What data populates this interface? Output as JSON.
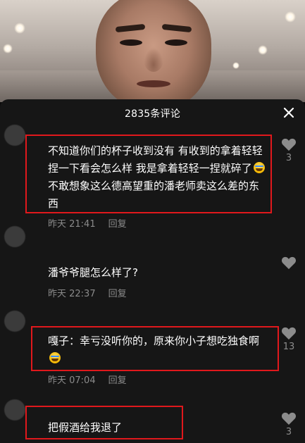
{
  "sheet": {
    "title": "2835条评论",
    "close_icon": "close-icon"
  },
  "comments": [
    {
      "text_part1": "不知道你们的杯子收到没有 有收到的拿着轻轻捏一下看会怎么样 我是拿着轻轻一捏就碎了",
      "emoji": "laughing-tears-emoji",
      "text_part2": " 不敢想象这么德高望重的潘老师卖这么差的东西",
      "time": "昨天 21:41",
      "reply": "回复",
      "likes": "3"
    },
    {
      "text_part1": "潘爷爷腿怎么样了?",
      "time": "昨天 22:37",
      "reply": "回复",
      "likes": ""
    },
    {
      "text_part1": "嘎子：幸亏没听你的，原来你小子想吃独食啊",
      "emoji": "laughing-tears-emoji",
      "time": "昨天 07:04",
      "reply": "回复",
      "likes": "13"
    },
    {
      "text_part1": "把假酒给我退了",
      "likes": "3"
    }
  ],
  "colors": {
    "sheet_bg": "#161616",
    "meta_text": "#8a8a8a",
    "highlight": "#e0181c"
  }
}
